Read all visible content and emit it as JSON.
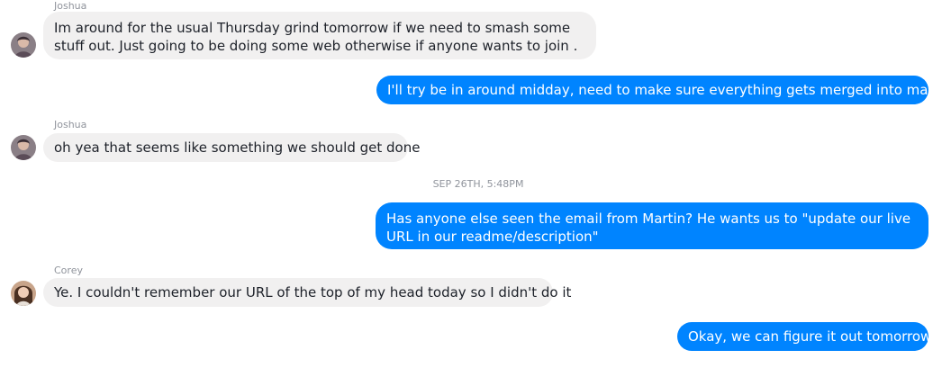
{
  "messages": [
    {
      "sender": "Joshua",
      "text": "Im around for the usual Thursday grind tomorrow if we need to smash some stuff out. Just going to be doing some web otherwise if anyone wants to join ."
    },
    {
      "text": "I'll try be in around midday, need to make sure everything gets merged into master"
    },
    {
      "sender": "Joshua",
      "text": "oh yea that seems like something we should get done"
    },
    {
      "timestamp": "SEP 26TH, 5:48PM"
    },
    {
      "text": "Has anyone else seen the email from Martin? He wants us to \"update our live URL in our readme/description\""
    },
    {
      "sender": "Corey",
      "text": "Ye. I couldn't remember our URL of the top of my head today so I didn't do it"
    },
    {
      "text": "Okay, we can figure it out tomorrow"
    }
  ],
  "colors": {
    "outgoing_bubble": "#0084ff",
    "incoming_bubble": "#f1f0f0",
    "meta_text": "#90949c"
  },
  "icons": {
    "joshua_avatar": "profile-photo",
    "corey_avatar": "profile-photo"
  }
}
